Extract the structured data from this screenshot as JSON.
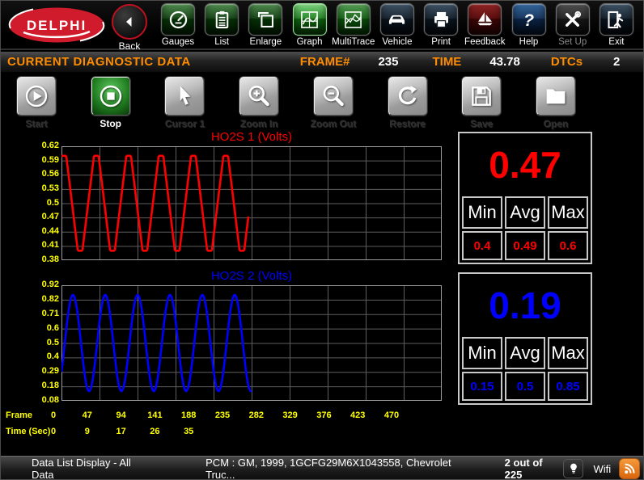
{
  "top_toolbar": {
    "logo_text": "DELPHI",
    "back_label": "Back",
    "buttons": [
      {
        "id": "gauges",
        "label": "Gauges"
      },
      {
        "id": "list",
        "label": "List"
      },
      {
        "id": "enlarge",
        "label": "Enlarge"
      },
      {
        "id": "graph",
        "label": "Graph"
      },
      {
        "id": "multitrace",
        "label": "MultiTrace"
      },
      {
        "id": "vehicle",
        "label": "Vehicle"
      },
      {
        "id": "print",
        "label": "Print"
      },
      {
        "id": "feedback",
        "label": "Feedback"
      },
      {
        "id": "help",
        "label": "Help"
      },
      {
        "id": "setup",
        "label": "Set Up"
      },
      {
        "id": "exit",
        "label": "Exit"
      }
    ]
  },
  "header": {
    "title": "CURRENT DIAGNOSTIC DATA",
    "frame_label": "FRAME#",
    "frame_value": "235",
    "time_label": "TIME",
    "time_value": "43.78",
    "dtcs_label": "DTCs",
    "dtcs_value": "2"
  },
  "graph_toolbar": {
    "buttons": [
      {
        "id": "start",
        "label": "Start",
        "enabled": false,
        "active": false
      },
      {
        "id": "stop",
        "label": "Stop",
        "enabled": true,
        "active": true
      },
      {
        "id": "cursor1",
        "label": "Cursor 1",
        "enabled": false,
        "active": false
      },
      {
        "id": "zoom-in",
        "label": "Zoom In",
        "enabled": false,
        "active": false
      },
      {
        "id": "zoom-out",
        "label": "Zoom Out",
        "enabled": false,
        "active": false
      },
      {
        "id": "restore",
        "label": "Restore",
        "enabled": false,
        "active": false
      },
      {
        "id": "save",
        "label": "Save",
        "enabled": false,
        "active": false
      },
      {
        "id": "open",
        "label": "Open",
        "enabled": false,
        "active": false
      }
    ]
  },
  "chart_data": [
    {
      "type": "line",
      "title": "HO2S 1 (Volts)",
      "color": "#ff0000",
      "y_ticks": [
        "0.62",
        "0.59",
        "0.56",
        "0.53",
        "0.5",
        "0.47",
        "0.44",
        "0.41",
        "0.38"
      ],
      "y_min": 0.38,
      "y_max": 0.62,
      "x_min": 0,
      "x_max": 470,
      "x_grid_step": 47,
      "data_end_frame": 231,
      "waveform": {
        "shape": "clipped-triangle",
        "mid": 0.5,
        "amplitude": 0.14,
        "clip_low": 0.4,
        "clip_high": 0.6,
        "period_frames": 40,
        "peak_frame": 3
      },
      "stats": {
        "current": "0.47",
        "min": "0.4",
        "avg": "0.49",
        "max": "0.6"
      }
    },
    {
      "type": "line",
      "title": "HO2S 2 (Volts)",
      "color": "#0000ff",
      "y_ticks": [
        "0.92",
        "0.82",
        "0.71",
        "0.6",
        "0.5",
        "0.4",
        "0.29",
        "0.18",
        "0.08"
      ],
      "y_min": 0.08,
      "y_max": 0.92,
      "x_min": 0,
      "x_max": 470,
      "x_grid_step": 47,
      "data_end_frame": 235,
      "waveform": {
        "shape": "sine",
        "mid": 0.5,
        "amplitude": 0.35,
        "period_frames": 40,
        "phase_frames": 4.1
      },
      "stats": {
        "current": "0.19",
        "min": "0.15",
        "avg": "0.5",
        "max": "0.85"
      }
    }
  ],
  "stats_headers": [
    "Min",
    "Avg",
    "Max"
  ],
  "x_axis": {
    "frame_label": "Frame",
    "time_label": "Time (Sec)",
    "frame_ticks": [
      "0",
      "47",
      "94",
      "141",
      "188",
      "235",
      "282",
      "329",
      "376",
      "423",
      "470"
    ],
    "time_ticks": [
      "0",
      "9",
      "17",
      "26",
      "35"
    ]
  },
  "status_bar": {
    "left_text": "Data List Display - All Data",
    "pcm_text": "PCM : GM, 1999, 1GCFG29M6X1043558, Chevrolet Truc...",
    "count_text": "2 out of 225",
    "wifi_label": "Wifi"
  },
  "colors": {
    "accent_orange": "#ff8c00",
    "tick_yellow": "#ffff00",
    "series1_red": "#ff0000",
    "series2_blue": "#0000ff"
  }
}
